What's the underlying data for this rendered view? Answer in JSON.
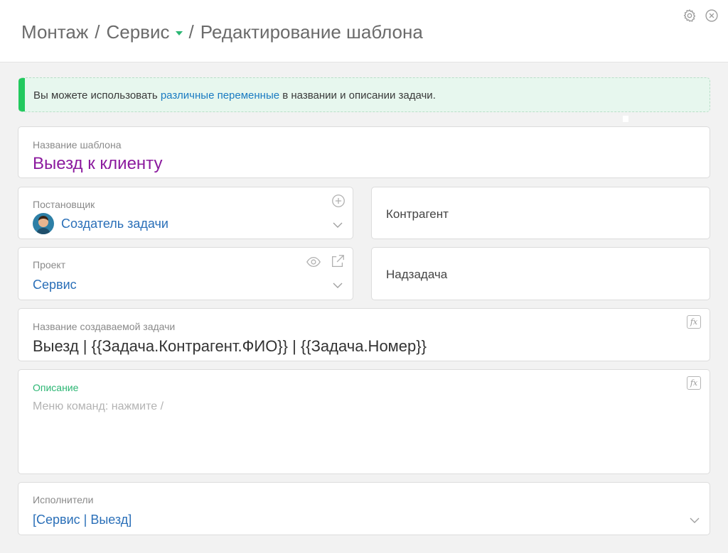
{
  "header": {
    "crumb_1": "Монтаж",
    "separator": "/",
    "crumb_2": "Сервис",
    "crumb_3": "Редактирование шаблона",
    "icons": [
      "gear-icon",
      "close-icon"
    ]
  },
  "notice": {
    "text_before": "Вы можете использовать ",
    "link": "различные переменные",
    "text_after": " в названии и описании задачи.",
    "accent": "#22c95e"
  },
  "template_name": {
    "label": "Название шаблона",
    "value": "Выезд к клиенту",
    "color": "#8b1a9e"
  },
  "author": {
    "label": "Постановщик",
    "value": "Создатель задачи"
  },
  "counterparty": {
    "label": "Контрагент"
  },
  "project": {
    "label": "Проект",
    "value": "Сервис"
  },
  "parent_task": {
    "label": "Надзадача"
  },
  "task_name": {
    "label": "Название создаваемой задачи",
    "value": "Выезд | {{Задача.Контрагент.ФИО}} | {{Задача.Номер}}",
    "fx": "fx"
  },
  "description": {
    "label": "Описание",
    "placeholder": "Меню команд: нажмите /",
    "fx": "fx"
  },
  "executors": {
    "label": "Исполнители",
    "value": "[Сервис | Выезд]"
  },
  "colors": {
    "link": "#1a7bc2",
    "value_blue": "#2a6fb8",
    "green": "#2bb673"
  }
}
